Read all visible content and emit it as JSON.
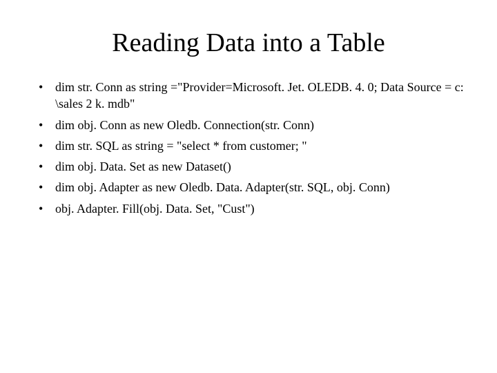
{
  "title": "Reading Data into a Table",
  "bullets": [
    "dim str. Conn as string =\"Provider=Microsoft. Jet. OLEDB. 4. 0; Data Source = c: \\sales 2 k. mdb\"",
    "dim obj. Conn as new Oledb. Connection(str. Conn)",
    "dim str. SQL as string = \"select * from customer; \"",
    "dim obj. Data. Set as new Dataset()",
    "dim obj. Adapter as new Oledb. Data. Adapter(str. SQL, obj. Conn)",
    "obj. Adapter. Fill(obj. Data. Set, \"Cust\")"
  ]
}
